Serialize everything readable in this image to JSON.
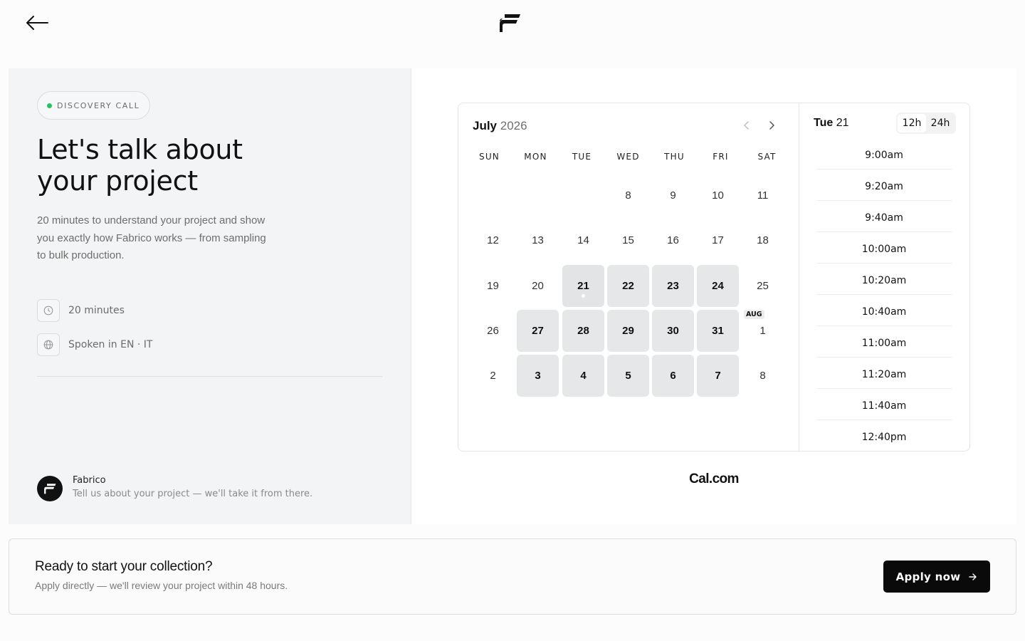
{
  "icons": {
    "back": "arrow-left-icon",
    "logo": "fabrico-logo",
    "duration": "clock-icon",
    "language": "globe-icon",
    "prev": "chevron-left-icon",
    "next": "chevron-right-icon",
    "cta": "arrow-right-icon"
  },
  "colors": {
    "status_dot": "#22c55e",
    "panel_bg": "#f3f4f5",
    "button_bg": "#0a0a0a"
  },
  "event": {
    "badge": "DISCOVERY CALL",
    "title_line1": "Let's talk about",
    "title_line2": "your project",
    "description": "20 minutes to understand your project and show you exactly how Fabrico works — from sampling to bulk production.",
    "duration": "20 minutes",
    "languages": "Spoken in EN · IT",
    "org_name": "Fabrico",
    "org_tagline": "Tell us about your project — we'll take it from there."
  },
  "calendar": {
    "month": "July",
    "year": "2026",
    "weekdays": [
      "SUN",
      "MON",
      "TUE",
      "WED",
      "THU",
      "FRI",
      "SAT"
    ],
    "next_month_badge": "AUG",
    "weeks": [
      [
        {
          "d": ""
        },
        {
          "d": ""
        },
        {
          "d": ""
        },
        {
          "d": "8"
        },
        {
          "d": "9"
        },
        {
          "d": "10"
        },
        {
          "d": "11"
        }
      ],
      [
        {
          "d": "12"
        },
        {
          "d": "13"
        },
        {
          "d": "14"
        },
        {
          "d": "15"
        },
        {
          "d": "16"
        },
        {
          "d": "17"
        },
        {
          "d": "18"
        }
      ],
      [
        {
          "d": "19"
        },
        {
          "d": "20"
        },
        {
          "d": "21",
          "available": true,
          "selected": true
        },
        {
          "d": "22",
          "available": true
        },
        {
          "d": "23",
          "available": true
        },
        {
          "d": "24",
          "available": true
        },
        {
          "d": "25"
        }
      ],
      [
        {
          "d": "26"
        },
        {
          "d": "27",
          "available": true
        },
        {
          "d": "28",
          "available": true
        },
        {
          "d": "29",
          "available": true
        },
        {
          "d": "30",
          "available": true
        },
        {
          "d": "31",
          "available": true
        },
        {
          "d": "1"
        }
      ],
      [
        {
          "d": "2"
        },
        {
          "d": "3",
          "available": true
        },
        {
          "d": "4",
          "available": true
        },
        {
          "d": "5",
          "available": true
        },
        {
          "d": "6",
          "available": true
        },
        {
          "d": "7",
          "available": true
        },
        {
          "d": "8"
        }
      ]
    ]
  },
  "slots": {
    "weekday": "Tue",
    "day": "21",
    "format_12h": "12h",
    "format_24h": "24h",
    "times": [
      "9:00am",
      "9:20am",
      "9:40am",
      "10:00am",
      "10:20am",
      "10:40am",
      "11:00am",
      "11:20am",
      "11:40am",
      "12:40pm"
    ]
  },
  "branding": {
    "text": "Cal.com"
  },
  "cta": {
    "title": "Ready to start your collection?",
    "subtitle": "Apply directly — we'll review your project within 48 hours.",
    "button": "Apply now"
  }
}
